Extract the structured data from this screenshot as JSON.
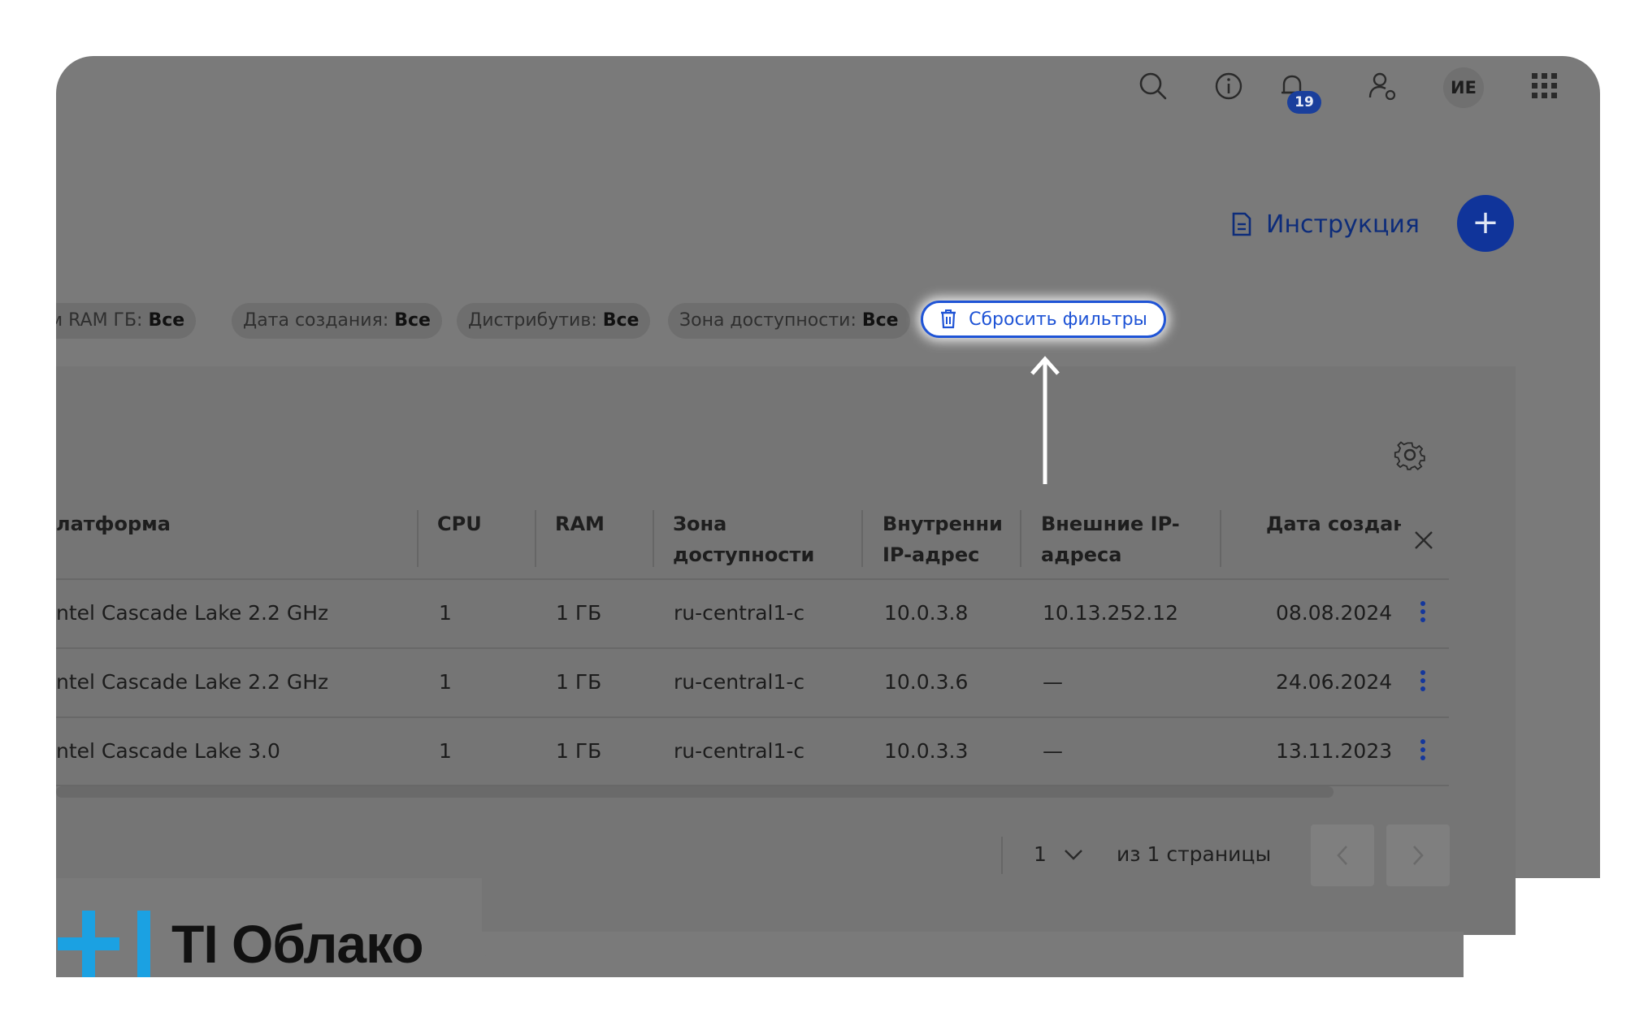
{
  "topbar": {
    "icons": [
      "search-icon",
      "info-icon",
      "bell-icon",
      "user-settings-icon",
      "apps-grid-icon"
    ],
    "notifications_count": "19",
    "avatar_initials": "ИЕ"
  },
  "header": {
    "instruction_label": "Инструкция",
    "add_button_icon": "+"
  },
  "filters": [
    {
      "label": "ем RAM ГБ:",
      "value": "Все"
    },
    {
      "label": "Дата создания:",
      "value": "Все"
    },
    {
      "label": "Дистрибутив:",
      "value": "Все"
    },
    {
      "label": "Зона доступности:",
      "value": "Все"
    }
  ],
  "reset_filters_label": "Сбросить фильтры",
  "table": {
    "columns": [
      {
        "line1": "латформа",
        "line2": ""
      },
      {
        "line1": "CPU",
        "line2": ""
      },
      {
        "line1": "RAM",
        "line2": ""
      },
      {
        "line1": "Зона",
        "line2": "доступности"
      },
      {
        "line1": "Внутренни",
        "line2": "IP-адрес"
      },
      {
        "line1": "Внешние IP-",
        "line2": "адреса"
      },
      {
        "line1": "Дата создан",
        "line2": ""
      }
    ],
    "rows": [
      [
        "ntel Cascade Lake 2.2 GHz",
        "1",
        "1 ГБ",
        "ru-central1-c",
        "10.0.3.8",
        "10.13.252.12",
        "08.08.2024"
      ],
      [
        "ntel Cascade Lake 2.2 GHz",
        "1",
        "1 ГБ",
        "ru-central1-c",
        "10.0.3.6",
        "—",
        "24.06.2024"
      ],
      [
        "ntel Cascade Lake 3.0",
        "1",
        "1 ГБ",
        "ru-central1-c",
        "10.0.3.3",
        "—",
        "13.11.2023"
      ]
    ]
  },
  "pagination": {
    "current_page": "1",
    "of_pages": "из 1 страницы"
  },
  "brand": {
    "name": "TI Облако",
    "colors": {
      "accent": "#1ba1e2",
      "mark_dark": "#0d73b8",
      "overlay": "#7a7a7a",
      "link": "#1f54d6"
    }
  }
}
